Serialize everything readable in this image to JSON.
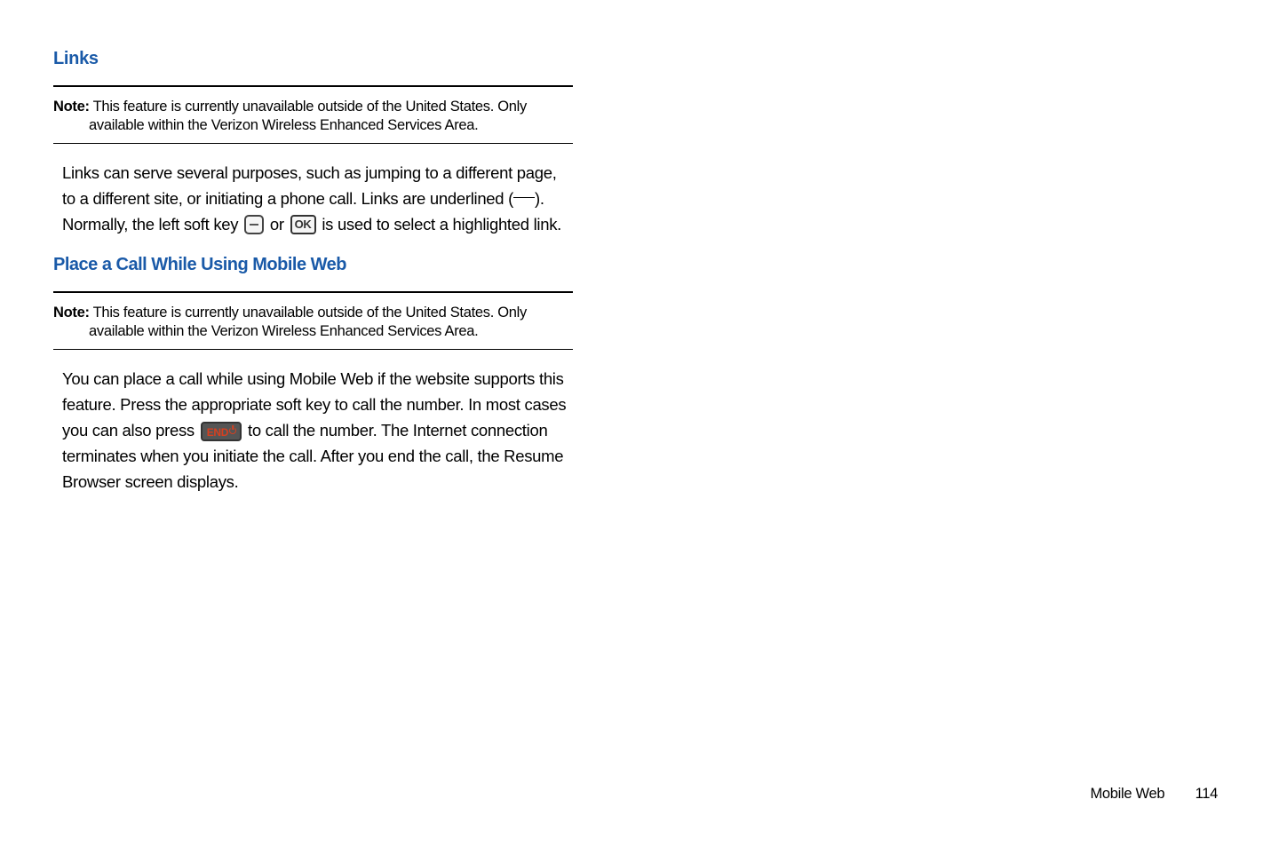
{
  "sections": {
    "links": {
      "heading": "Links",
      "note_label": "Note:",
      "note_text": " This feature is currently unavailable outside of the United States. Only available within the Verizon Wireless Enhanced Services Area.",
      "body_p1_a": "Links can serve several purposes, such as jumping to a different page, to a different site, or initiating a phone call. Links are underlined (",
      "body_p1_b": "). Normally, the left soft key ",
      "body_p1_c": " or ",
      "body_p1_d": " is used to select a highlighted link."
    },
    "place_call": {
      "heading": "Place a Call While Using Mobile Web",
      "note_label": "Note:",
      "note_text": " This feature is currently unavailable outside of the United States. Only available within the Verizon Wireless Enhanced Services Area.",
      "body_p1_a": "You can place a call while using Mobile Web if the website supports this feature. Press the appropriate soft key to call the number. In most cases you can also press ",
      "body_p1_b": " to call the number. The Internet connection terminates when you initiate the call. After you end the call, the Resume Browser screen displays."
    }
  },
  "icons": {
    "ok_label": "OK",
    "end_label": "END"
  },
  "footer": {
    "title": "Mobile Web",
    "page": "114"
  }
}
